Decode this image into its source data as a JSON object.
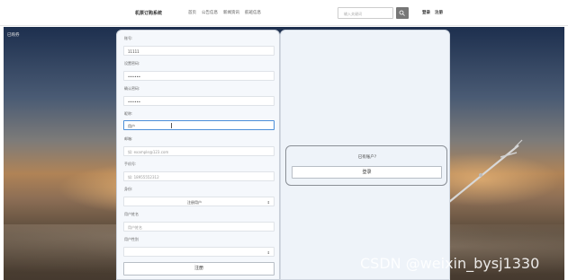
{
  "nav": {
    "brand": "机票订购系统",
    "links": [
      "首页",
      "公告信息",
      "新闻资讯",
      "航班信息"
    ],
    "search_placeholder": "输入关键词",
    "login": "登录",
    "register": "注册"
  },
  "hero": {
    "top_label": "已购券"
  },
  "form": {
    "account_label": "账号:",
    "account_value": "11111",
    "password_label": "设置密码:",
    "password_value": "••••••",
    "confirm_label": "确认密码:",
    "confirm_value": "••••••",
    "nickname_label": "昵称:",
    "nickname_value": "用户",
    "email_label": "邮箱:",
    "email_placeholder": "如: example@123.com",
    "phone_label": "手机号:",
    "phone_placeholder": "如: 18955552312",
    "identity_label": "身份:",
    "identity_value": "注册用户",
    "realname_label": "用户姓名",
    "realname_placeholder": "用户姓名",
    "gender_label": "用户性别",
    "gender_value": "",
    "submit_label": "注册"
  },
  "side": {
    "have_account": "已有账户?",
    "login_label": "登录"
  },
  "watermark": "CSDN @weixin_bysj1330"
}
